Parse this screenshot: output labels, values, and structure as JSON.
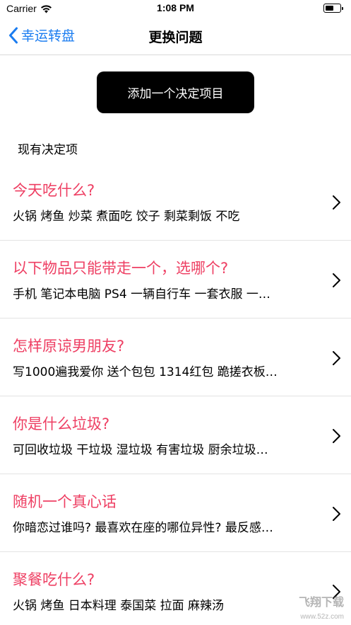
{
  "status_bar": {
    "carrier": "Carrier",
    "time": "1:08 PM",
    "battery_level": 0.6
  },
  "nav": {
    "back_label": "幸运转盘",
    "title": "更换问题"
  },
  "add_button_label": "添加一个决定项目",
  "section_header": "现有决定项",
  "items": [
    {
      "title": "今天吃什么?",
      "options": "火锅  烤鱼  炒菜  煮面吃  饺子  剩菜剩饭  不吃"
    },
    {
      "title": "以下物品只能带走一个，选哪个?",
      "options": "手机  笔记本电脑  PS4  一辆自行车  一套衣服  一…"
    },
    {
      "title": "怎样原谅男朋友?",
      "options": "写1000遍我爱你  送个包包  1314红包  跪搓衣板…"
    },
    {
      "title": "你是什么垃圾?",
      "options": "可回收垃圾  干垃圾  湿垃圾  有害垃圾  厨余垃圾…"
    },
    {
      "title": "随机一个真心话",
      "options": "你暗恋过谁吗?  最喜欢在座的哪位异性?  最反感…"
    },
    {
      "title": "聚餐吃什么?",
      "options": "火锅  烤鱼  日本料理  泰国菜  拉面  麻辣汤"
    }
  ],
  "watermark": {
    "text": "飞翔下载",
    "url": "www.52z.com"
  },
  "colors": {
    "accent_blue": "#1a7cf0",
    "title_pink": "#ee3f63"
  }
}
